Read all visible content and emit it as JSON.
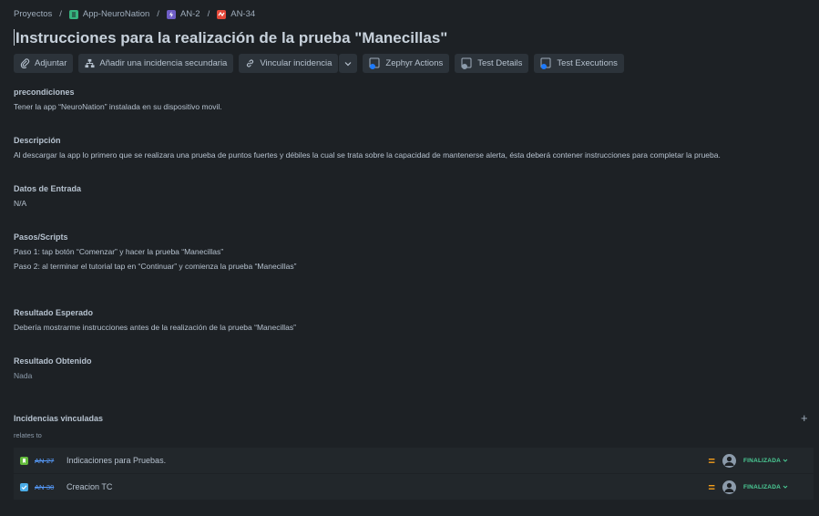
{
  "breadcrumb": {
    "projects": "Proyectos",
    "sep": "/",
    "project": "App-NeuroNation",
    "epic": "AN-2",
    "issue": "AN-34"
  },
  "title": "Instrucciones para la realización de la prueba \"Manecillas\"",
  "toolbar": {
    "attach": "Adjuntar",
    "add_child": "Añadir una incidencia secundaria",
    "link_issue": "Vincular incidencia",
    "zephyr": "Zephyr Actions",
    "test_details": "Test Details",
    "test_exec": "Test Executions"
  },
  "sections": {
    "precond_title": "precondiciones",
    "precond_body": "Tener la app “NeuroNation” instalada en su dispositivo movil.",
    "desc_title": "Descripción",
    "desc_body": "Al descargar la app lo primero que se realizara una prueba de puntos fuertes y débiles la cual se trata sobre la capacidad de mantenerse alerta, ésta deberá contener instrucciones para completar la prueba.",
    "input_title": "Datos de Entrada",
    "input_body": "N/A",
    "steps_title": "Pasos/Scripts",
    "step1": "Paso 1: tap botón “Comenzar” y hacer la prueba “Manecillas”",
    "step2": "Paso 2: al terminar el tutorial tap en “Continuar” y comienza la prueba “Manecillas”",
    "expected_title": "Resultado Esperado",
    "expected_body": "Debería mostrarme instrucciones antes de la realización de la prueba “Manecillas”",
    "obtained_title": "Resultado Obtenido",
    "obtained_body": "Nada"
  },
  "linked": {
    "header": "Incidencias vinculadas",
    "relation": "relates to",
    "items": [
      {
        "key": "AN-27",
        "summary": "Indicaciones para Pruebas.",
        "status": "FINALIZADA",
        "type_icon": "story-icon"
      },
      {
        "key": "AN-30",
        "summary": "Creacion TC",
        "status": "FINALIZADA",
        "type_icon": "task-icon"
      }
    ]
  },
  "colors": {
    "background": "#1d2125",
    "status_done": "#4bce97",
    "priority": "#f59f1b",
    "link": "#579dff"
  }
}
